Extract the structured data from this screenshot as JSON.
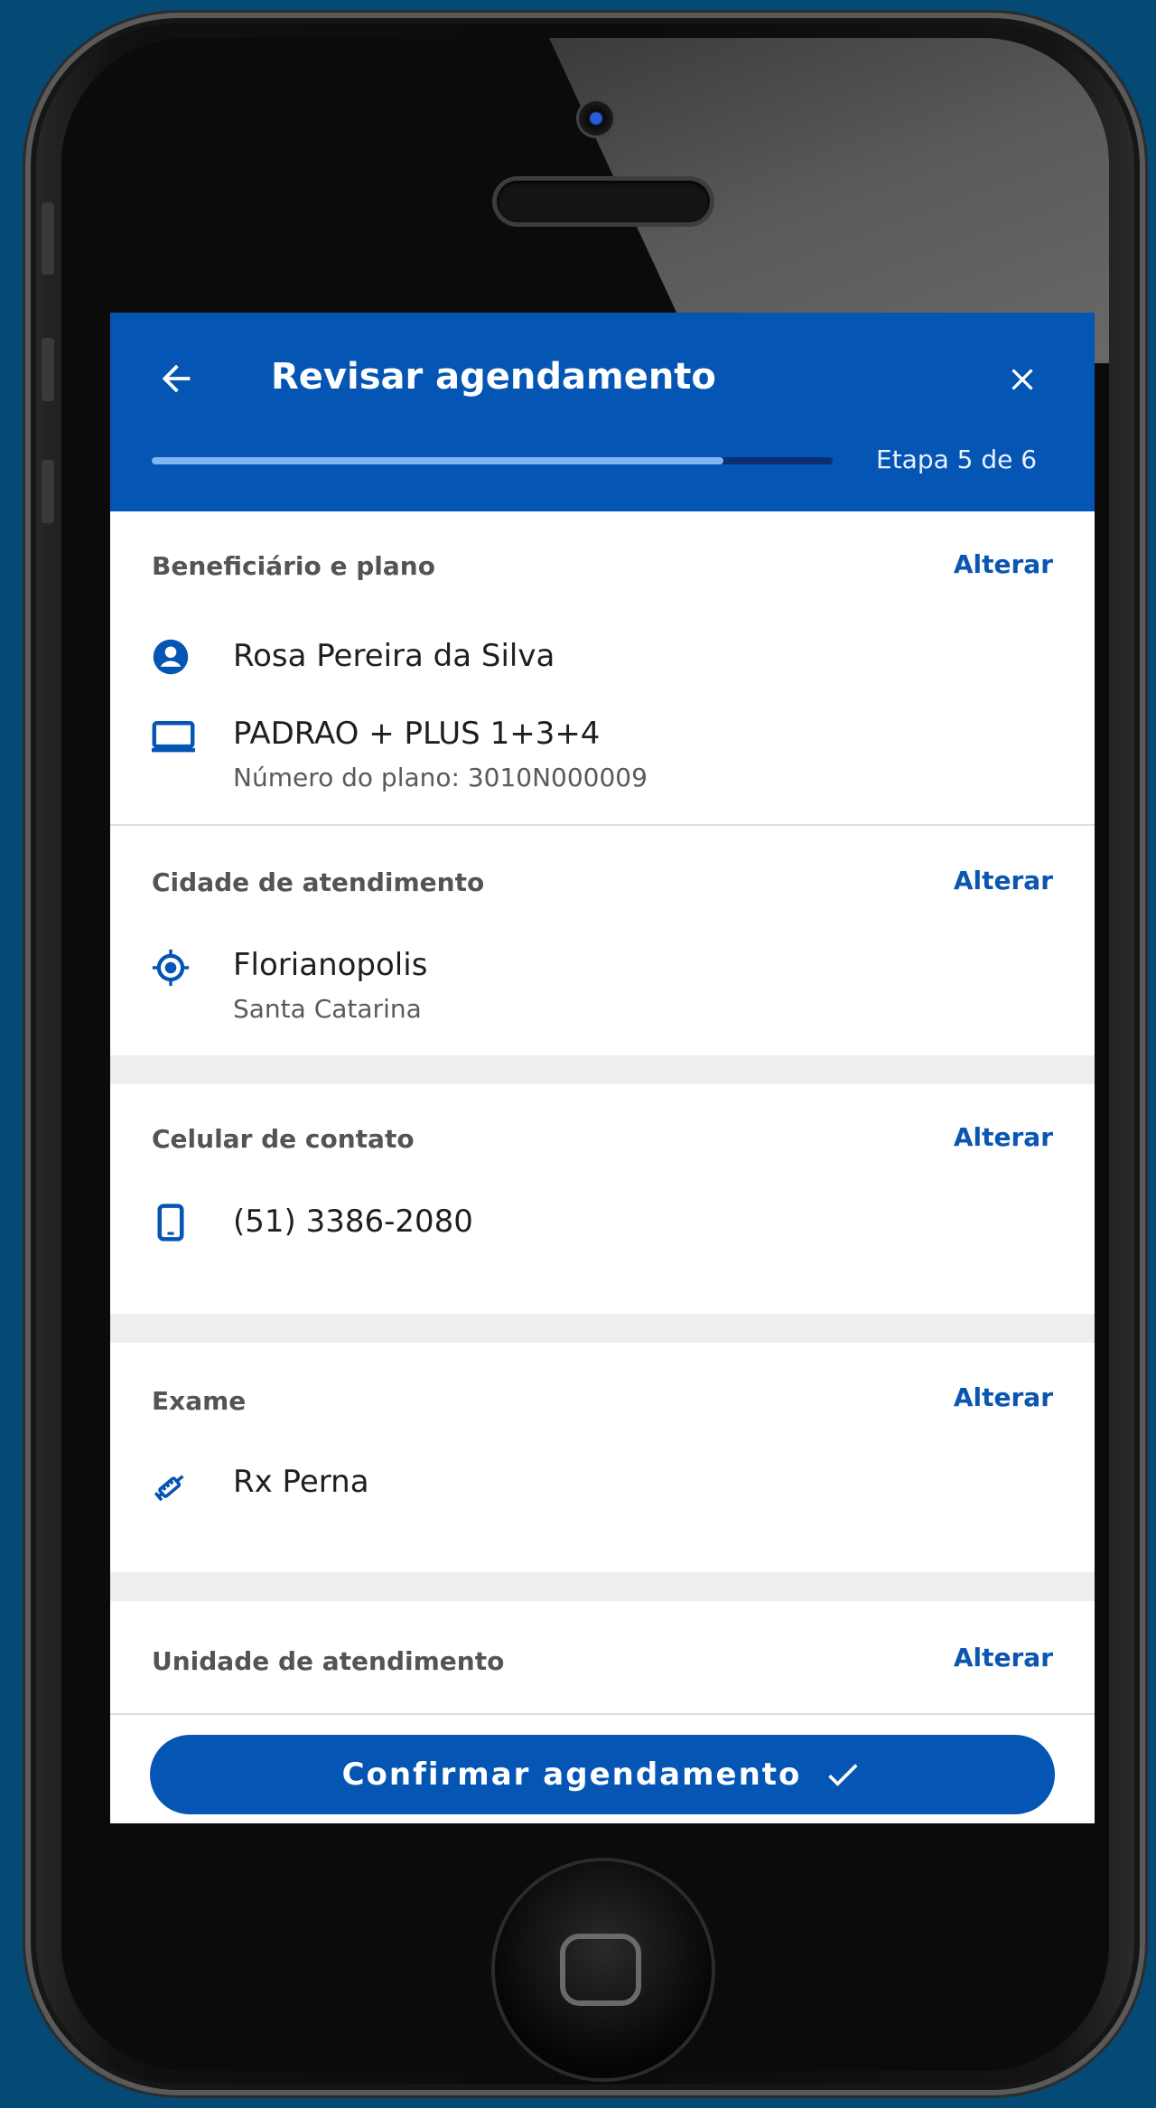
{
  "header": {
    "title": "Revisar agendamento",
    "step_label": "Etapa 5 de 6",
    "progress": 0.84
  },
  "sections": {
    "beneficiary": {
      "label": "Beneficiário e plano",
      "action": "Alterar",
      "name": "Rosa Pereira da Silva",
      "plan": "PADRAO + PLUS 1+3+4",
      "plan_number": "Número do plano: 3010N000009"
    },
    "city": {
      "label": "Cidade de atendimento",
      "action": "Alterar",
      "city": "Florianopolis",
      "state": "Santa Catarina"
    },
    "phone": {
      "label": "Celular de contato",
      "action": "Alterar",
      "number": "(51) 3386-2080"
    },
    "exam": {
      "label": "Exame",
      "action": "Alterar",
      "name": "Rx Perna"
    },
    "unit": {
      "label": "Unidade de atendimento",
      "action": "Alterar"
    }
  },
  "confirm_button": {
    "label": "Confirmar agendamento"
  },
  "colors": {
    "primary": "#0555b4",
    "progress_fill": "#7fb6f2",
    "background": "#054a74"
  }
}
